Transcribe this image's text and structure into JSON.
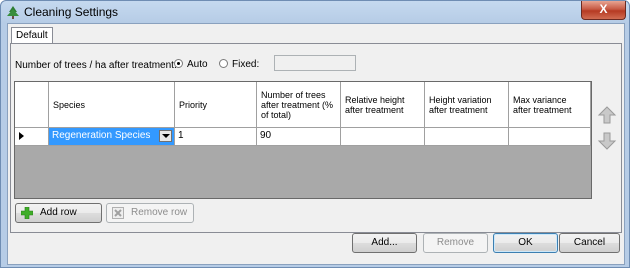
{
  "window": {
    "title": "Cleaning Settings",
    "close_label": "X"
  },
  "tabs": [
    {
      "label": "Default"
    }
  ],
  "trees_row": {
    "label": "Number of trees / ha after treatment:",
    "options": [
      {
        "label": "Auto",
        "selected": true
      },
      {
        "label": "Fixed:",
        "selected": false
      }
    ],
    "fixed_value": ""
  },
  "grid": {
    "columns": [
      "Species",
      "Priority",
      "Number of trees after treatment (% of total)",
      "Relative height after treatment",
      "Height variation after treatment",
      "Max variance after treatment"
    ],
    "rows": [
      {
        "species": "Regeneration Species",
        "priority": "1",
        "trees_pct": "90",
        "rel_height": "",
        "height_var": "",
        "max_var": ""
      }
    ]
  },
  "grid_buttons": {
    "add_row": "Add row",
    "remove_row": "Remove row"
  },
  "footer": {
    "add": "Add...",
    "remove": "Remove",
    "ok": "OK",
    "cancel": "Cancel"
  },
  "colors": {
    "selection": "#3399ff",
    "grid_empty": "#a9a9a9",
    "add_icon": "#3fae29"
  }
}
